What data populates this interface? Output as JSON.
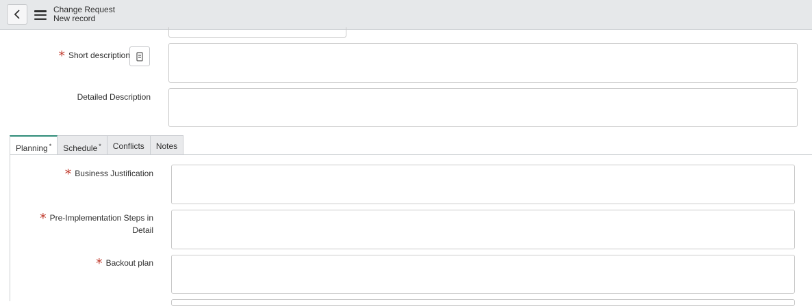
{
  "header": {
    "title": "Change Request",
    "subtitle": "New record"
  },
  "form": {
    "short_description": {
      "label": "Short description",
      "value": ""
    },
    "detailed_description": {
      "label": "Detailed Description",
      "value": ""
    }
  },
  "tabs": [
    {
      "label": "Planning",
      "marker": "*",
      "active": true
    },
    {
      "label": "Schedule",
      "marker": "*",
      "active": false
    },
    {
      "label": "Conflicts",
      "marker": "",
      "active": false
    },
    {
      "label": "Notes",
      "marker": "",
      "active": false
    }
  ],
  "planning": {
    "business_justification": {
      "label": "Business Justification",
      "value": ""
    },
    "pre_implementation_line1": "Pre-Implementation Steps in",
    "pre_implementation_line2": "Detail",
    "backout_plan": {
      "label": "Backout plan",
      "value": ""
    }
  },
  "colors": {
    "required": "#c0392b",
    "active_tab": "#2e8b78",
    "header_bg": "#e6e8ea"
  },
  "icons": {
    "back": "chevron-left-icon",
    "menu": "hamburger-icon",
    "reference": "template-icon"
  }
}
